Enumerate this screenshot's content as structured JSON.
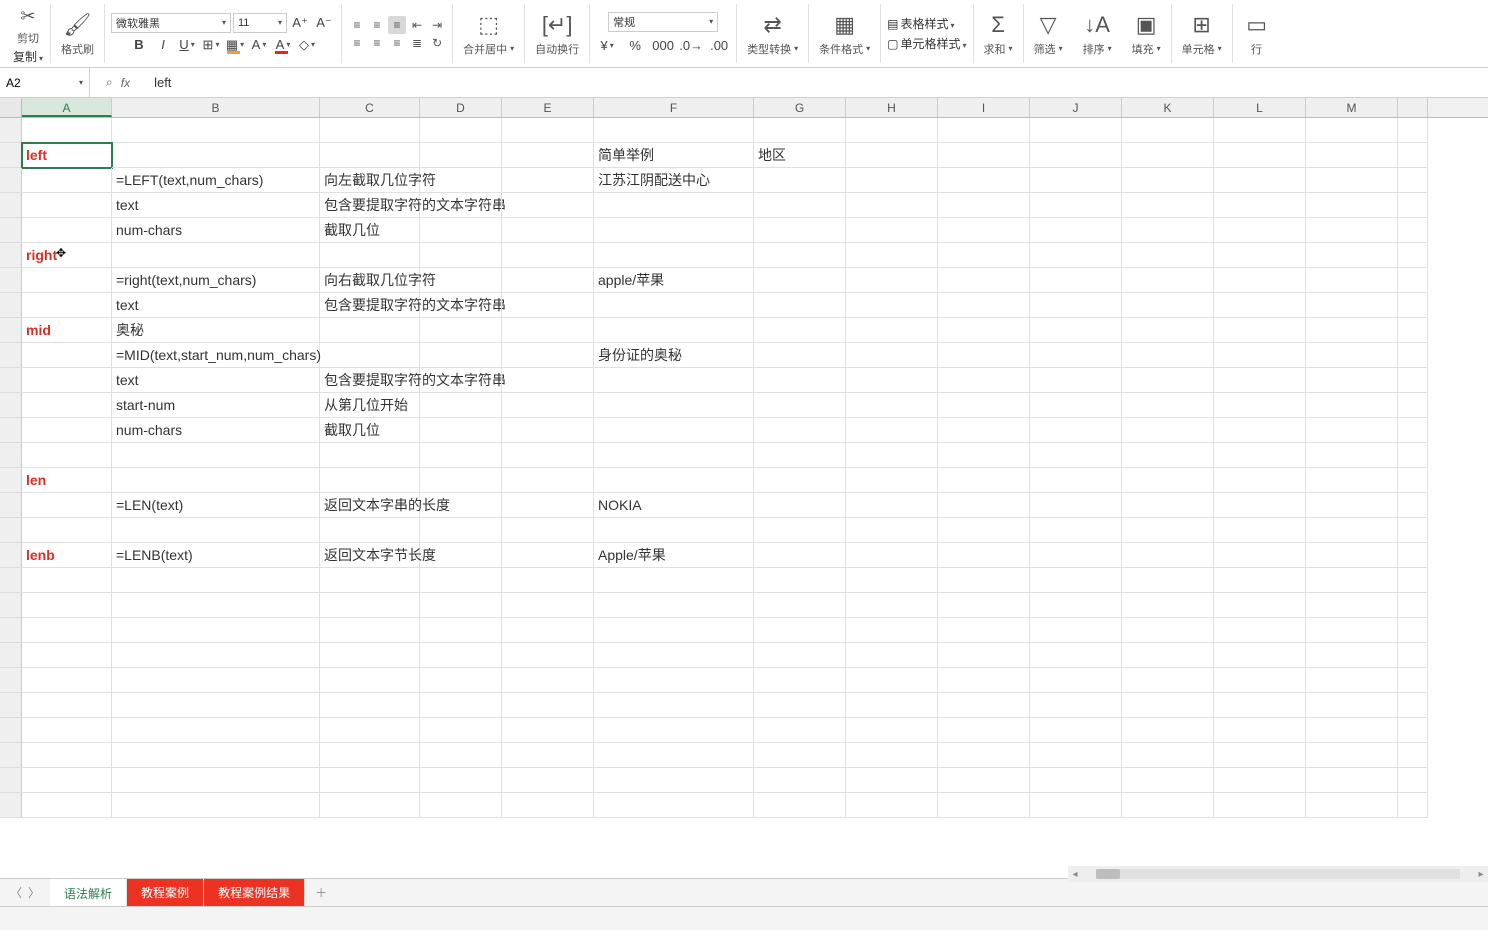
{
  "ribbon": {
    "cut": "剪切",
    "copy": "复制",
    "fmtpaint": "格式刷",
    "font_name": "微软雅黑",
    "font_size": "11",
    "merge": "合并居中",
    "wrap": "自动换行",
    "numfmt": "常规",
    "type_conv": "类型转换",
    "cond_fmt": "条件格式",
    "table_style": "表格样式",
    "cell_style": "单元格样式",
    "sum": "求和",
    "filter": "筛选",
    "sort": "排序",
    "fill": "填充",
    "cells": "单元格",
    "rowcol": "行"
  },
  "namebox": "A2",
  "formula": "left",
  "columns": [
    "A",
    "B",
    "C",
    "D",
    "E",
    "F",
    "G",
    "H",
    "I",
    "J",
    "K",
    "L",
    "M",
    ""
  ],
  "cells": {
    "r2": {
      "A": "left",
      "F": "简单举例",
      "G": "地区"
    },
    "r3": {
      "B": "=LEFT(text,num_chars)",
      "C": "向左截取几位字符",
      "F": "江苏江阴配送中心"
    },
    "r4": {
      "B": "text",
      "C": "包含要提取字符的文本字符串"
    },
    "r5": {
      "B": "num-chars",
      "C": "截取几位"
    },
    "r6": {
      "A": "right"
    },
    "r7": {
      "B": "=right(text,num_chars)",
      "C": "向右截取几位字符",
      "F": "apple/苹果"
    },
    "r8": {
      "B": "text",
      "C": "包含要提取字符的文本字符串"
    },
    "r9": {
      "A": "mid",
      "B": "奥秘"
    },
    "r10": {
      "B": "=MID(text,start_num,num_chars)",
      "F": "身份证的奥秘"
    },
    "r11": {
      "B": "text",
      "C": "包含要提取字符的文本字符串"
    },
    "r12": {
      "B": "start-num",
      "C": "从第几位开始"
    },
    "r13": {
      "B": "num-chars",
      "C": "截取几位"
    },
    "r15": {
      "A": "len"
    },
    "r16": {
      "B": "=LEN(text)",
      "C": "返回文本字串的长度",
      "F": "NOKIA"
    },
    "r18": {
      "A": "lenb",
      "B": "=LENB(text)",
      "C": "返回文本字节长度",
      "F": "Apple/苹果"
    }
  },
  "sheets": {
    "s1": "语法解析",
    "s2": "教程案例",
    "s3": "教程案例结果"
  }
}
